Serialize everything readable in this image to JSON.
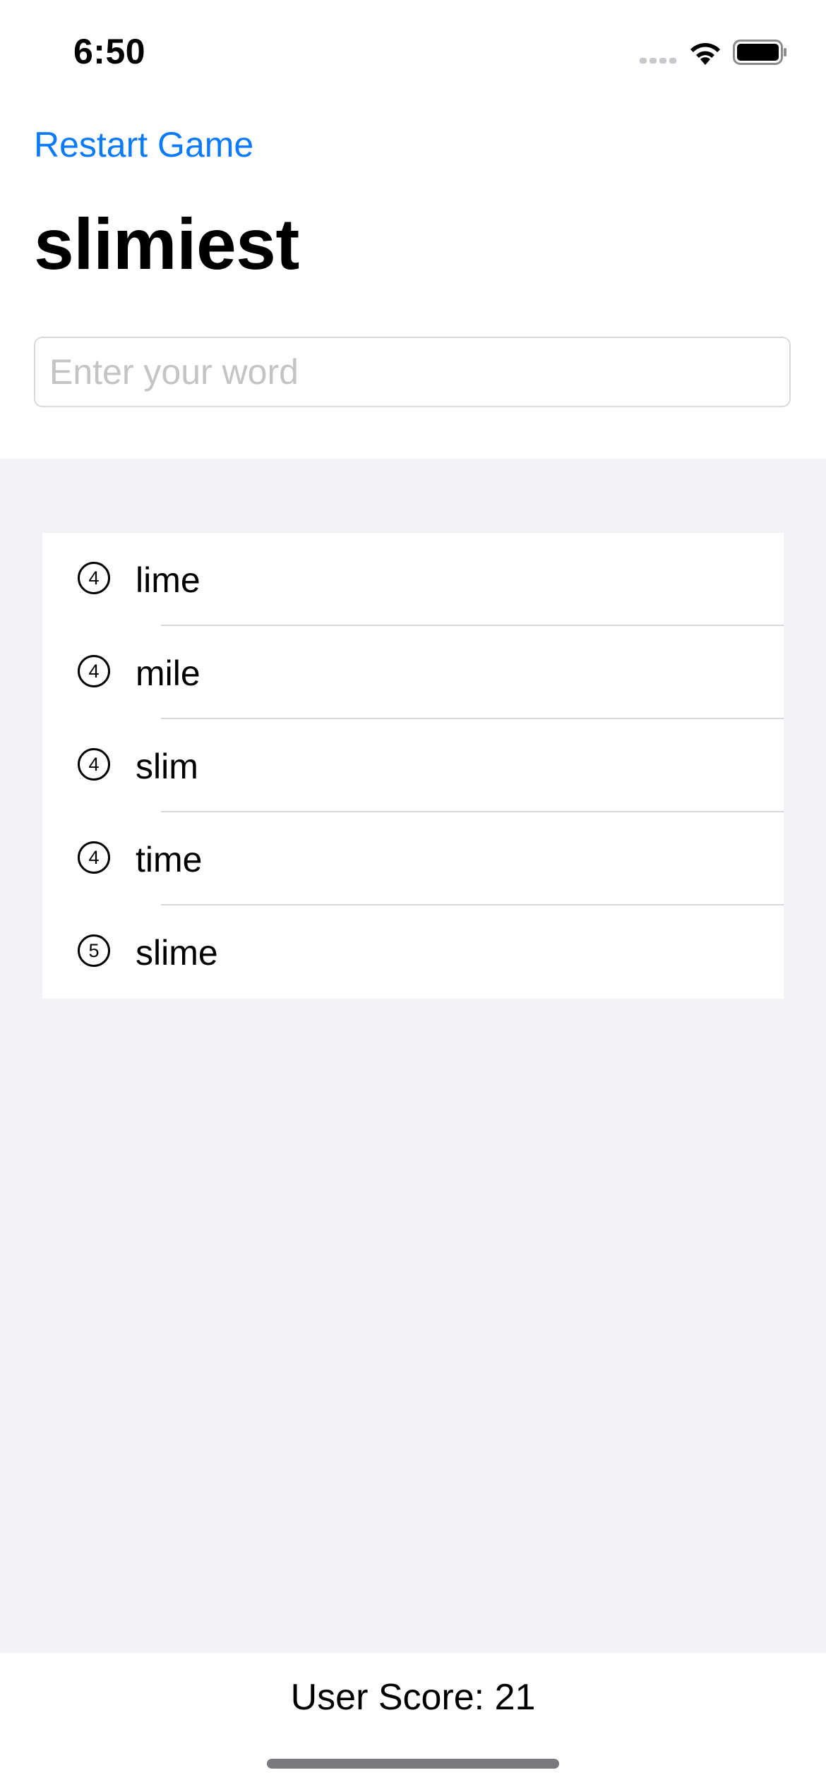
{
  "status_bar": {
    "time": "6:50",
    "icons": [
      "cellular-signal-icon",
      "wifi-icon",
      "battery-icon"
    ]
  },
  "header": {
    "restart_label": "Restart Game",
    "root_word": "slimiest"
  },
  "input": {
    "placeholder": "Enter your word",
    "value": ""
  },
  "used_words": [
    {
      "length": "4",
      "word": "lime"
    },
    {
      "length": "4",
      "word": "mile"
    },
    {
      "length": "4",
      "word": "slim"
    },
    {
      "length": "4",
      "word": "time"
    },
    {
      "length": "5",
      "word": "slime"
    }
  ],
  "footer": {
    "score_text": "User Score: 21"
  },
  "colors": {
    "accent": "#0a7aff",
    "list_background": "#f2f2f7",
    "placeholder": "#c4c4c7"
  }
}
